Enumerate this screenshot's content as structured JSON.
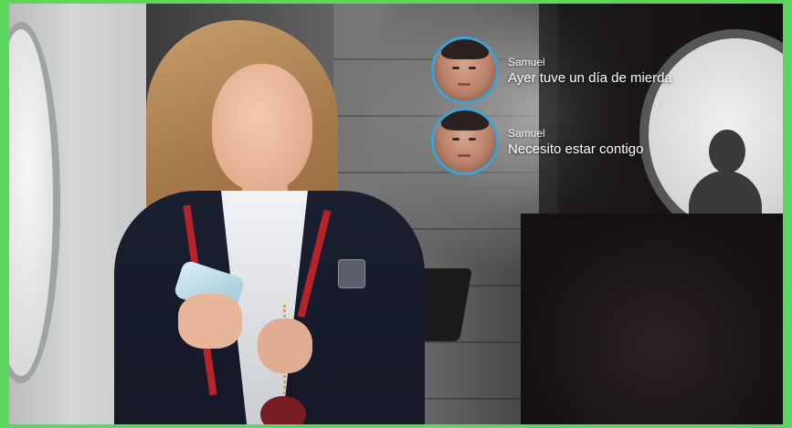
{
  "notifications": [
    {
      "sender": "Samuel",
      "message": "Ayer tuve un día de mierda",
      "avatar_icon": "user-avatar"
    },
    {
      "sender": "Samuel",
      "message": "Necesito estar contigo",
      "avatar_icon": "user-avatar"
    }
  ],
  "colors": {
    "border": "#5cd65c",
    "avatar_ring": "#3aa3d8",
    "blazer": "#1b2031",
    "trim": "#b8232a"
  }
}
